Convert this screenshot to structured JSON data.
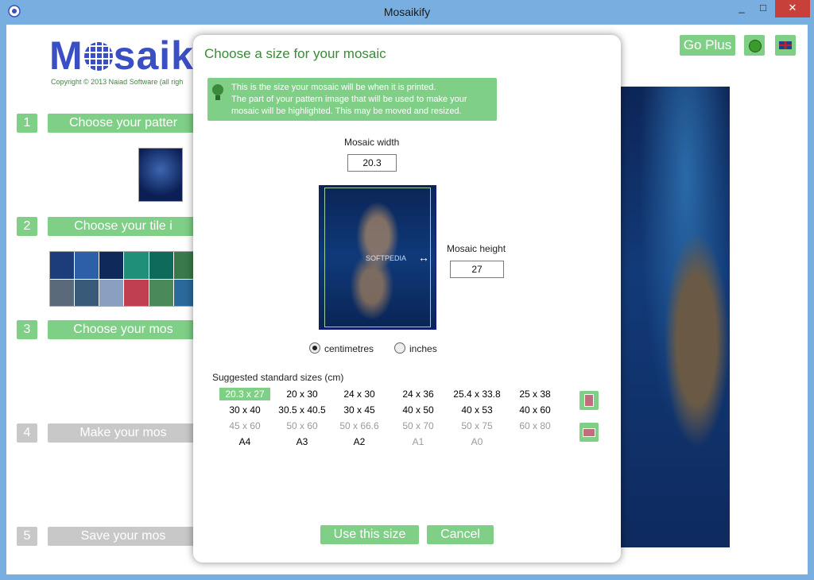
{
  "window": {
    "title": "Mosaikify"
  },
  "controls": {
    "minimize": "_",
    "maximize": "□",
    "close": "✕"
  },
  "app": {
    "logo": {
      "pre": "M",
      "post": "saik"
    },
    "copyright": "Copyright © 2013 Naiad Software (all righ",
    "go_plus": "Go Plus",
    "steps": [
      {
        "num": "1",
        "label": "Choose your patter"
      },
      {
        "num": "2",
        "label": "Choose your tile i"
      },
      {
        "num": "3",
        "label": "Choose your mos"
      },
      {
        "num": "4",
        "label": "Make your mos"
      },
      {
        "num": "5",
        "label": "Save your mos"
      }
    ]
  },
  "dialog": {
    "title": "Choose a size for your mosaic",
    "hint": [
      "This is the size your mosaic will be when it is printed.",
      "The part of your pattern image that will be used to make your",
      "mosaic will be highlighted. This may be moved and resized."
    ],
    "width_label": "Mosaic width",
    "width_value": "20.3",
    "height_label": "Mosaic height",
    "height_value": "27",
    "preview_watermark": "SOFTPEDIA",
    "units": {
      "cm": "centimetres",
      "in": "inches",
      "selected": "cm"
    },
    "sizes_label": "Suggested standard sizes (cm)",
    "sizes": [
      [
        "20.3 x 27",
        "20 x 30",
        "24 x 30",
        "24 x 36",
        "25.4 x 33.8",
        "25 x 38"
      ],
      [
        "30 x 40",
        "30.5 x 40.5",
        "30 x 45",
        "40 x 50",
        "40 x 53",
        "40 x 60"
      ],
      [
        "45 x 60",
        "50 x 60",
        "50 x 66.6",
        "50 x 70",
        "50 x 75",
        "60 x 80"
      ],
      [
        "A4",
        "A3",
        "A2",
        "A1",
        "A0"
      ]
    ],
    "use_button": "Use this size",
    "cancel_button": "Cancel"
  },
  "colors": {
    "accent_green": "#7fcf86",
    "title_green": "#3a8a3a",
    "logo_blue": "#3b4fc4"
  }
}
